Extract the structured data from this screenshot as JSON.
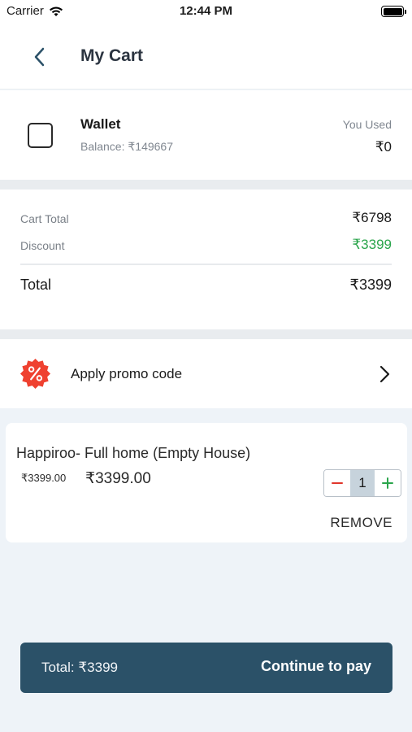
{
  "status_bar": {
    "carrier": "Carrier",
    "time": "12:44 PM"
  },
  "header": {
    "title": "My Cart"
  },
  "wallet": {
    "label": "Wallet",
    "balance": "Balance: ₹149667",
    "used_label": "You Used",
    "used_value": "₹0",
    "checked": false
  },
  "summary": {
    "cart_total_label": "Cart Total",
    "cart_total_value": "₹6798",
    "discount_label": "Discount",
    "discount_value": "₹3399",
    "total_label": "Total",
    "total_value": "₹3399"
  },
  "promo": {
    "label": "Apply promo code",
    "icon": "percent-badge-icon"
  },
  "items": [
    {
      "title": "Happiroo- Full home (Empty House)",
      "old_price": "₹3399.00",
      "price": "₹3399.00",
      "quantity": "1",
      "remove_label": "REMOVE"
    }
  ],
  "pay_bar": {
    "total": "Total: ₹3399",
    "button_label": "Continue to pay"
  },
  "colors": {
    "accent": "#2b5168",
    "discount_green": "#2aa54b",
    "minus_red": "#e0362b",
    "promo_red": "#ef4130"
  }
}
